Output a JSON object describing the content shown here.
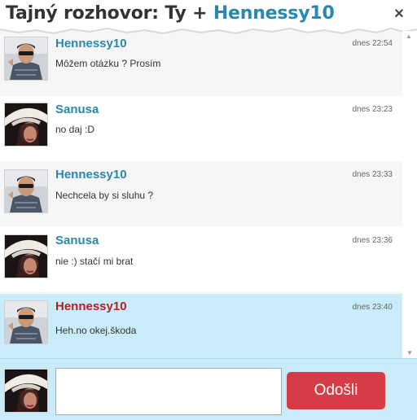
{
  "header": {
    "title_prefix": "Tajný rozhovor: Ty + ",
    "title_name": "Hennessy10",
    "close_label": "×"
  },
  "messages": [
    {
      "author": "Hennessy10",
      "time": "dnes 22:54",
      "text": "Môžem otázku ? Prosím"
    },
    {
      "author": "Sanusa",
      "time": "dnes 23:23",
      "text": "no daj :D"
    },
    {
      "author": "Hennessy10",
      "time": "dnes 23:33",
      "text": "Nechcela by si sluhu ?"
    },
    {
      "author": "Sanusa",
      "time": "dnes 23:36",
      "text": "nie :) stačí mi brat"
    },
    {
      "author": "Hennessy10",
      "time": "dnes 23:40",
      "text": "Heh.no okej.škoda"
    }
  ],
  "composer": {
    "input_value": "",
    "send_label": "Odošli"
  },
  "colors": {
    "accent": "#2a87ad",
    "highlight_author": "#b22222",
    "highlight_bg": "#c8ecf9",
    "send_button": "#d53c46"
  },
  "icons": {
    "close": "close-icon",
    "avatar_hennessy": "avatar-man-sunglasses",
    "avatar_sanusa": "avatar-woman-hat"
  }
}
